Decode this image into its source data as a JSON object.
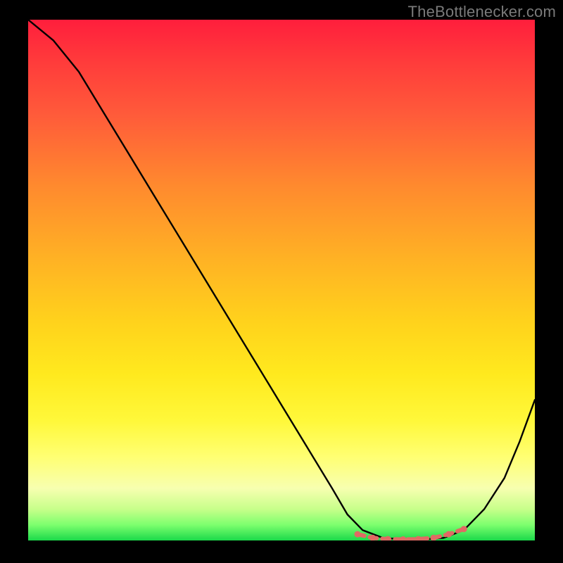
{
  "attribution": "TheBottlenecker.com",
  "chart_data": {
    "type": "line",
    "title": "",
    "xlabel": "",
    "ylabel": "",
    "xlim": [
      0,
      100
    ],
    "ylim": [
      0,
      100
    ],
    "series": [
      {
        "name": "curve",
        "x": [
          0,
          5,
          10,
          15,
          20,
          25,
          30,
          35,
          40,
          45,
          50,
          55,
          60,
          63,
          66,
          70,
          74,
          78,
          82,
          86,
          90,
          94,
          97,
          100
        ],
        "y": [
          100,
          96,
          90,
          82,
          74,
          66,
          58,
          50,
          42,
          34,
          26,
          18,
          10,
          5,
          2,
          0.5,
          0.2,
          0.2,
          0.5,
          2,
          6,
          12,
          19,
          27
        ]
      }
    ],
    "markers": {
      "name": "highlight-range",
      "color": "#e06a64",
      "x": [
        65,
        68,
        71,
        74,
        77,
        80,
        83,
        86
      ],
      "y": [
        1.2,
        0.5,
        0.25,
        0.2,
        0.25,
        0.5,
        1.2,
        2.2
      ]
    },
    "background_gradient_stops": [
      {
        "pos": 0.0,
        "color": "#ff1e3c"
      },
      {
        "pos": 0.08,
        "color": "#ff3b3b"
      },
      {
        "pos": 0.18,
        "color": "#ff5a3a"
      },
      {
        "pos": 0.32,
        "color": "#ff8a2e"
      },
      {
        "pos": 0.46,
        "color": "#ffb224"
      },
      {
        "pos": 0.58,
        "color": "#ffd21c"
      },
      {
        "pos": 0.68,
        "color": "#ffe91e"
      },
      {
        "pos": 0.77,
        "color": "#fff83a"
      },
      {
        "pos": 0.84,
        "color": "#ffff73"
      },
      {
        "pos": 0.9,
        "color": "#f7ffb0"
      },
      {
        "pos": 0.94,
        "color": "#c7ff8a"
      },
      {
        "pos": 0.97,
        "color": "#7dff6e"
      },
      {
        "pos": 1.0,
        "color": "#1bd94a"
      }
    ]
  }
}
